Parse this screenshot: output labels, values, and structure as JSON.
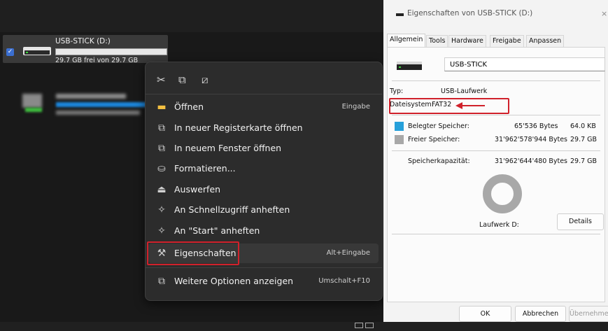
{
  "explorer": {
    "drive": {
      "name": "USB-STICK (D:)",
      "free_text": "29.7 GB frei von 29.7 GB",
      "checkbox": "✓"
    },
    "blurred_drive": {
      "icon": "drive-icon",
      "bar_color": "#1c87dd"
    }
  },
  "context_menu": {
    "quick_actions": [
      {
        "icon": "cut-icon",
        "glyph": "✂"
      },
      {
        "icon": "copy-icon",
        "glyph": "⧉"
      },
      {
        "icon": "rename-icon",
        "glyph": "⧄"
      }
    ],
    "items": [
      {
        "label": "Öffnen",
        "shortcut": "Eingabe",
        "icon": "folder-icon",
        "glyph": "▬"
      },
      {
        "label": "In neuer Registerkarte öffnen",
        "shortcut": "",
        "icon": "new-tab-icon",
        "glyph": "⧉"
      },
      {
        "label": "In neuem Fenster öffnen",
        "shortcut": "",
        "icon": "new-window-icon",
        "glyph": "⧉"
      },
      {
        "label": "Formatieren...",
        "shortcut": "",
        "icon": "format-icon",
        "glyph": "⛀"
      },
      {
        "label": "Auswerfen",
        "shortcut": "",
        "icon": "eject-icon",
        "glyph": "⏏"
      },
      {
        "label": "An Schnellzugriff anheften",
        "shortcut": "",
        "icon": "pin-icon",
        "glyph": "✧"
      },
      {
        "label": "An \"Start\" anheften",
        "shortcut": "",
        "icon": "pin-start-icon",
        "glyph": "✧"
      },
      {
        "label": "Eigenschaften",
        "shortcut": "Alt+Eingabe",
        "icon": "wrench-icon",
        "glyph": "⚒"
      },
      {
        "label": "Weitere Optionen anzeigen",
        "shortcut": "Umschalt+F10",
        "icon": "more-options-icon",
        "glyph": "⧉"
      }
    ]
  },
  "dialog": {
    "title": "Eigenschaften von USB-STICK (D:)",
    "close": "×",
    "tabs": [
      "Allgemein",
      "Tools",
      "Hardware",
      "Freigabe",
      "Anpassen"
    ],
    "volume_name": "USB-STICK",
    "type_label": "Typ:",
    "type_value": "USB-Laufwerk",
    "fs_label": "Dateisystem:",
    "fs_value": "FAT32",
    "used": {
      "label": "Belegter Speicher:",
      "bytes": "65'536 Bytes",
      "size": "64.0 KB",
      "color": "#26a0da"
    },
    "free": {
      "label": "Freier Speicher:",
      "bytes": "31'962'578'944 Bytes",
      "size": "29.7 GB",
      "color": "#a8a8a8"
    },
    "capacity": {
      "label": "Speicherkapazität:",
      "bytes": "31'962'644'480 Bytes",
      "size": "29.7 GB"
    },
    "usage_fraction": 2e-06,
    "drive_label": "Laufwerk D:",
    "details_button": "Details",
    "buttons": {
      "ok": "OK",
      "cancel": "Abbrechen",
      "apply": "Übernehmen"
    }
  },
  "colors": {
    "highlight_red": "#d0212b"
  }
}
